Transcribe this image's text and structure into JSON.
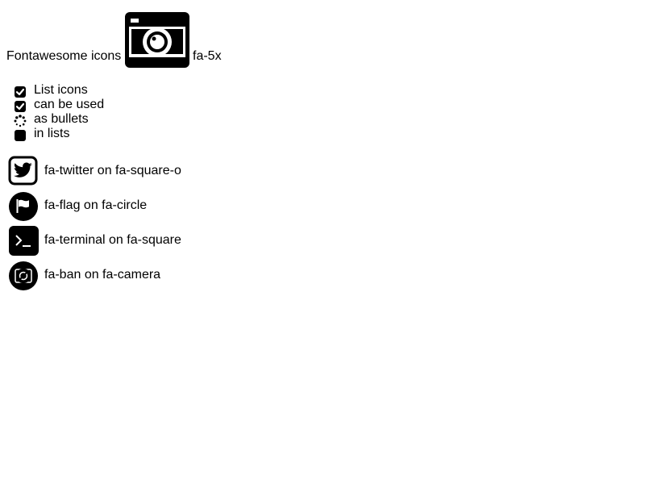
{
  "heading": {
    "text": "Fontawesome icons",
    "icon": "camera-icon",
    "suffix": "fa-5x"
  },
  "list": [
    {
      "label": "List icons",
      "icon": "check-square-icon"
    },
    {
      "label": "can be used",
      "icon": "check-square-icon"
    },
    {
      "label": "as bullets",
      "icon": "spinner-icon"
    },
    {
      "label": "in lists",
      "icon": "square-icon"
    }
  ],
  "stacks": [
    {
      "label": "fa-twitter on fa-square-o",
      "icon": "twitter-on-square-o-icon"
    },
    {
      "label": "fa-flag on fa-circle",
      "icon": "flag-on-circle-icon"
    },
    {
      "label": "fa-terminal on fa-square",
      "icon": "terminal-on-square-icon"
    },
    {
      "label": "fa-ban on fa-camera",
      "icon": "ban-on-camera-icon"
    }
  ]
}
